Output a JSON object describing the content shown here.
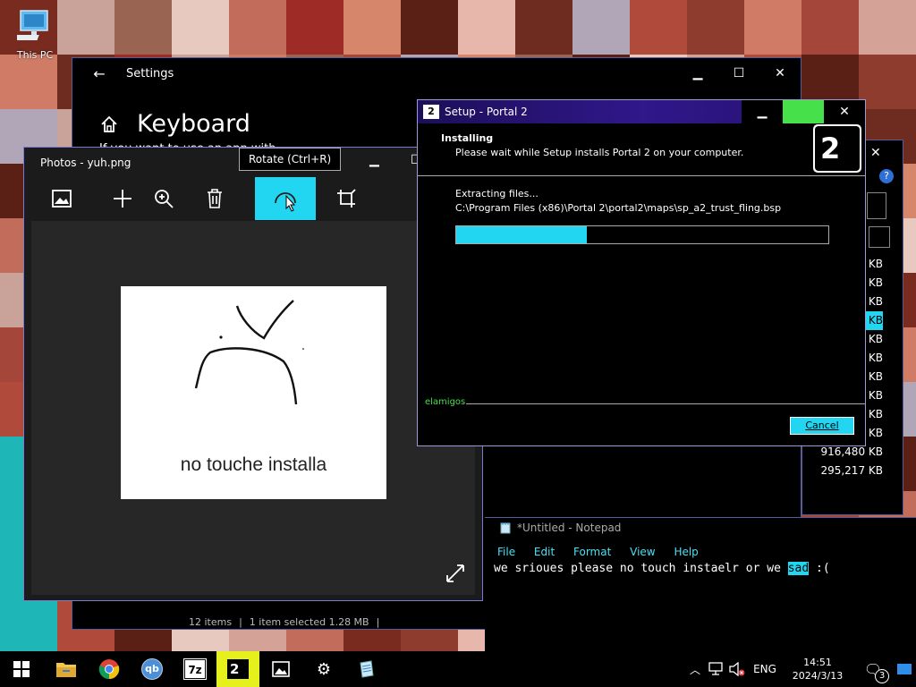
{
  "desktop": {
    "this_pc_label": "This PC",
    "wallpaper_colors": [
      "#7a2b1f",
      "#b04a3a",
      "#d6866a",
      "#c9a39a",
      "#8e3c2d",
      "#5a1f15",
      "#9a6452",
      "#cf7b66",
      "#e6b7aa",
      "#e8c9c0",
      "#a5463a",
      "#6e2c20",
      "#c26d5b",
      "#d4a296",
      "#b0a6b8",
      "#9e2b26"
    ]
  },
  "settings": {
    "title": "Settings",
    "heading": "Keyboard",
    "partial_text": "If you want to use an app with a different keyboard than the",
    "status_items": "12 items",
    "status_selected": "1 item selected  1.28 MB"
  },
  "photos": {
    "title": "Photos - yuh.png",
    "tooltip": "Rotate (Ctrl+R)",
    "image_caption": "no touche installa"
  },
  "setup": {
    "title": "Setup - Portal 2",
    "heading": "Installing",
    "subheading": "Please wait while Setup installs Portal 2 on your computer.",
    "status_label": "Extracting files...",
    "file_path": "C:\\Program Files (x86)\\Portal 2\\portal2\\maps\\sp_a2_trust_fling.bsp",
    "progress": 0.35,
    "brand": "elamigos",
    "cancel_label": "Cancel",
    "logo_text": "2"
  },
  "notepad": {
    "title": "*Untitled - Notepad",
    "menu": [
      "File",
      "Edit",
      "Format",
      "View",
      "Help"
    ],
    "text_before": "we srioues please no touch instaelr or we ",
    "text_selected": "sad",
    "text_after": " :("
  },
  "explorer": {
    "sizes": [
      "KB",
      "KB",
      "KB",
      "KB",
      "KB",
      "KB",
      "KB",
      "KB",
      "KB",
      "KB",
      "916,480 KB",
      "295,217 KB"
    ],
    "selected_index": 3
  },
  "taskbar": {
    "language": "ENG",
    "time": "14:51",
    "date": "2024/3/13",
    "notification_count": "3",
    "qb_label": "qb",
    "sevenzip_label": "7z",
    "portal_label": "2"
  },
  "colors": {
    "accent": "#22d6f2",
    "setup_title_bg": "#2b1880",
    "taskbar_active": "#e6f01c"
  }
}
